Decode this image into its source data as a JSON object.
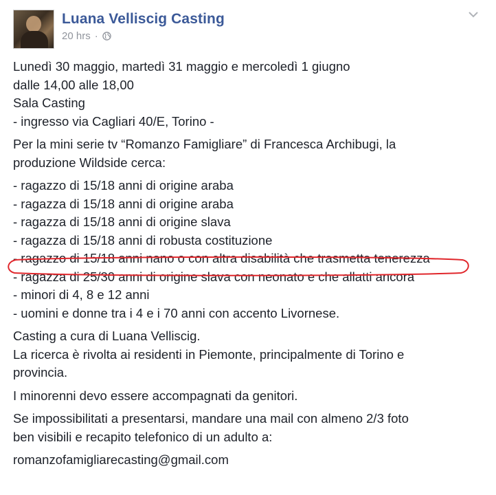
{
  "post": {
    "author": "Luana Velliscig Casting",
    "time": "20 hrs",
    "meta_dot": "·",
    "icons": {
      "audience": "globe-icon",
      "options": "chevron-down-icon"
    },
    "highlight_color": "#e0262b",
    "link_color": "#3b5998",
    "schedule": [
      "Lunedì 30 maggio, martedì 31 maggio e mercoledì 1 giugno",
      "dalle 14,00 alle 18,00",
      "Sala Casting",
      "- ingresso via Cagliari 40/E, Torino -"
    ],
    "intro": [
      "Per la mini serie tv “Romanzo Famigliare” di Francesca Archibugi, la",
      "produzione Wildside cerca:"
    ],
    "roles": [
      "- ragazzo di 15/18 anni di origine araba",
      "- ragazza di 15/18 anni di origine araba",
      "- ragazza di 15/18 anni di origine slava",
      "- ragazza di 15/18 anni di robusta costituzione",
      "- ragazzo di 15/18 anni nano o con altra disabilità che trasmetta tenerezza",
      "- ragazza di 25/30 anni di origine slava con neonato e che allatti ancora",
      "- minori di 4, 8 e 12 anni",
      "- uomini e donne tra i 4 e i 70 anni con accento Livornese."
    ],
    "casting_info": [
      "Casting a cura di Luana Velliscig.",
      "La ricerca è rivolta ai residenti in Piemonte, principalmente di Torino e",
      "provincia."
    ],
    "minors_note": "I minorenni devo essere accompagnati da genitori.",
    "contact": [
      "Se impossibilitati a presentarsi, mandare una mail con almeno 2/3 foto",
      "ben visibili e recapito telefonico di un adulto a:"
    ],
    "email": "romanzofamigliarecasting@gmail.com"
  }
}
